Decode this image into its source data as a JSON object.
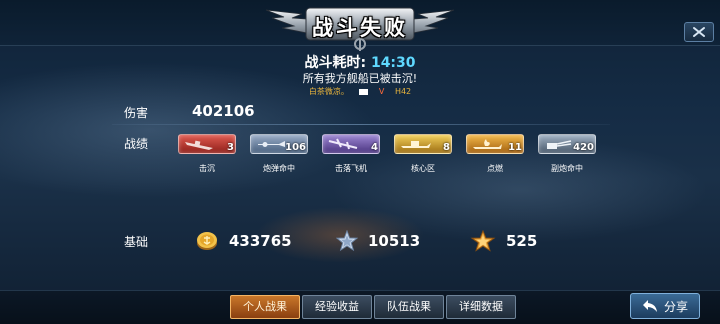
{
  "header": {
    "title": "战斗失败"
  },
  "battle": {
    "time_label": "战斗耗时:",
    "time_value": "14:30",
    "summary": "所有我方舰船已被击沉!",
    "player_name": "白茶微凉。",
    "grade": "V",
    "ship_code": "H42"
  },
  "damage": {
    "label": "伤害",
    "value": "402106"
  },
  "record": {
    "label": "战绩",
    "medals": [
      {
        "name": "击沉",
        "count": "3",
        "color": "#c8352c",
        "icon": "sunk-ship-icon"
      },
      {
        "name": "炮弹命中",
        "count": "106",
        "color": "#6f86a6",
        "icon": "shell-hit-icon"
      },
      {
        "name": "击落飞机",
        "count": "4",
        "color": "#7760ad",
        "icon": "plane-down-icon"
      },
      {
        "name": "核心区",
        "count": "8",
        "color": "#d1a52c",
        "icon": "core-hit-icon"
      },
      {
        "name": "点燃",
        "count": "11",
        "color": "#d99a24",
        "icon": "fire-icon"
      },
      {
        "name": "副炮命中",
        "count": "420",
        "color": "#6c7f93",
        "icon": "secondary-gun-icon"
      }
    ]
  },
  "base": {
    "label": "基础",
    "silver": "433765",
    "exp": "10513",
    "merit": "525"
  },
  "tabs": [
    {
      "label": "个人战果",
      "active": true
    },
    {
      "label": "经验收益",
      "active": false
    },
    {
      "label": "队伍战果",
      "active": false
    },
    {
      "label": "详细数据",
      "active": false
    }
  ],
  "share": {
    "label": "分享"
  },
  "colors": {
    "accent": "#5fd9ff",
    "active_tab": "#c9772a",
    "player_name": "#e9b43c"
  }
}
